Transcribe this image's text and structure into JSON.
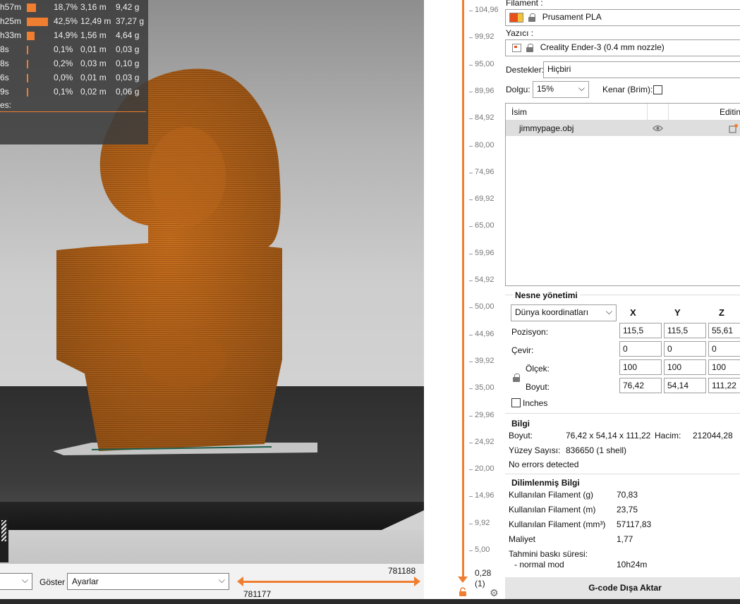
{
  "stats": {
    "rows": [
      {
        "time": "h57m",
        "percent": "18,7%",
        "length": "3,16 m",
        "weight": "9,42 g",
        "fraction": 0.187
      },
      {
        "time": "h25m",
        "percent": "42,5%",
        "length": "12,49 m",
        "weight": "37,27 g",
        "fraction": 0.425
      },
      {
        "time": "h33m",
        "percent": "14,9%",
        "length": "1,56 m",
        "weight": "4,64 g",
        "fraction": 0.149
      },
      {
        "time": "8s",
        "percent": "0,1%",
        "length": "0,01 m",
        "weight": "0,03 g",
        "fraction": 0.001
      },
      {
        "time": "8s",
        "percent": "0,2%",
        "length": "0,03 m",
        "weight": "0,10 g",
        "fraction": 0.002
      },
      {
        "time": "6s",
        "percent": "0,0%",
        "length": "0,01 m",
        "weight": "0,03 g",
        "fraction": 0.0
      },
      {
        "time": "9s",
        "percent": "0,1%",
        "length": "0,02 m",
        "weight": "0,06 g",
        "fraction": 0.001
      }
    ],
    "footer": "es:"
  },
  "bottom_bar": {
    "view_select_value": "",
    "show_label": "Göster",
    "show_select_value": "Ayarlar",
    "h_slider_top": "781188",
    "h_slider_bottom": "781177"
  },
  "layer_slider": {
    "labels": [
      "104,96",
      "99,92",
      "95,00",
      "89,96",
      "84,92",
      "80,00",
      "74,96",
      "69,92",
      "65,00",
      "59,96",
      "54,92",
      "50,00",
      "44,96",
      "39,92",
      "35,00",
      "29,96",
      "24,92",
      "20,00",
      "14,96",
      "9,92",
      "5,00"
    ],
    "bottom_value": "0,28",
    "bottom_count": "(1)"
  },
  "panel": {
    "filament_label": "Filament :",
    "filament_value": "Prusament PLA",
    "filament_color": "#f07e30",
    "printer_label": "Yazıcı :",
    "printer_value": "Creality Ender-3 (0.4 mm nozzle)",
    "supports_label": "Destekler:",
    "supports_value": "Hiçbiri",
    "infill_label": "Dolgu:",
    "infill_value": "15%",
    "brim_label": "Kenar (Brim):",
    "objects": {
      "col_name": "İsim",
      "col_edit": "Editin",
      "items": [
        {
          "name": "jimmypage.obj"
        }
      ]
    },
    "object_manip": {
      "title": "Nesne yönetimi",
      "coord_select": "Dünya koordinatları",
      "axes": [
        "X",
        "Y",
        "Z"
      ],
      "position_label": "Pozisyon:",
      "rotate_label": "Çevir:",
      "scale_label": "Ölçek:",
      "size_label": "Boyut:",
      "position": [
        "115,5",
        "115,5",
        "55,61"
      ],
      "rotate": [
        "0",
        "0",
        "0"
      ],
      "scale": [
        "100",
        "100",
        "100"
      ],
      "size": [
        "76,42",
        "54,14",
        "111,22"
      ],
      "inches_label": "Inches"
    },
    "info": {
      "title": "Bilgi",
      "size_label": "Boyut:",
      "size_value": "76,42 x 54,14 x 111,22",
      "volume_label": "Hacim:",
      "volume_value": "212044,28",
      "facets_label": "Yüzey Sayısı:",
      "facets_value": "836650 (1 shell)",
      "errors": "No errors detected"
    },
    "sliced": {
      "title": "Dilimlenmiş Bilgi",
      "fil_g_label": "Kullanılan Filament (g)",
      "fil_g_value": "70,83",
      "fil_m_label": "Kullanılan Filament (m)",
      "fil_m_value": "23,75",
      "fil_mm3_label": "Kullanılan Filament (mm³)",
      "fil_mm3_value": "57117,83",
      "cost_label": "Maliyet",
      "cost_value": "1,77",
      "time_label": "Tahmini baskı süresi:",
      "mode_label": "- normal mod",
      "mode_value": "10h24m"
    },
    "export_button": "G-code Dışa Aktar"
  }
}
